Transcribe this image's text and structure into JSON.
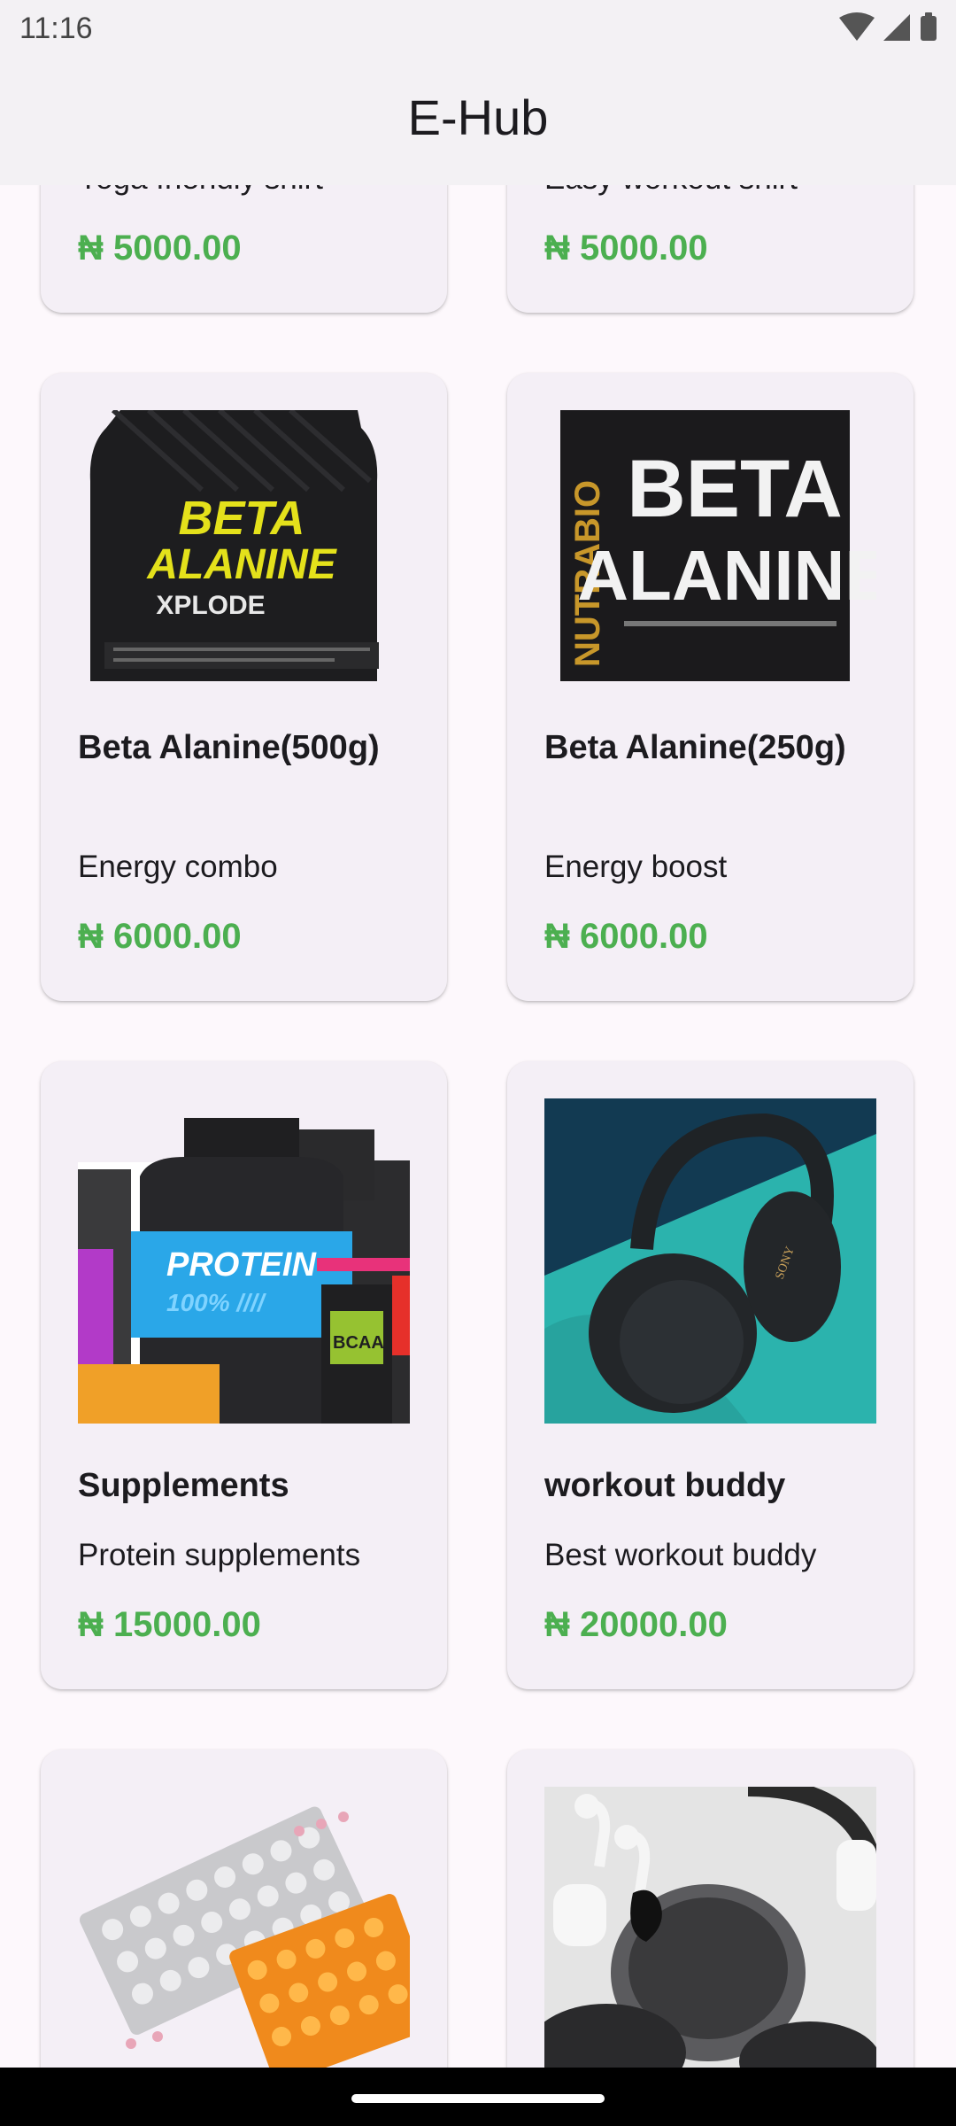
{
  "status_bar": {
    "time": "11:16",
    "icons": [
      "wifi-icon",
      "cellular-signal-icon",
      "battery-icon"
    ]
  },
  "app_bar": {
    "title": "E-Hub"
  },
  "currency_color": "#4caf50",
  "products": [
    {
      "name": "",
      "description": "Yoga friendly shirt",
      "price": "₦ 5000.00"
    },
    {
      "name": "",
      "description": "Easy workout shirt",
      "price": "₦ 5000.00"
    },
    {
      "name": "Beta Alanine(500g)",
      "description": "Energy combo",
      "price": "₦ 6000.00",
      "image": "beta-alanine-xplode-jar"
    },
    {
      "name": "Beta Alanine(250g)",
      "description": "Energy boost",
      "price": "₦ 6000.00",
      "image": "beta-alanine-nutrabio-jar"
    },
    {
      "name": "Supplements",
      "description": "Protein supplements",
      "price": "₦ 15000.00",
      "image": "protein-supplements"
    },
    {
      "name": "workout buddy",
      "description": "Best workout buddy",
      "price": "₦ 20000.00",
      "image": "sony-headphones"
    },
    {
      "name": "",
      "description": "",
      "price": "",
      "image": "pill-blister-packs"
    },
    {
      "name": "",
      "description": "",
      "price": "",
      "image": "apple-earbuds-headphones"
    }
  ],
  "product_image_labels": {
    "beta_500_line1": "BETA",
    "beta_500_line2": "ALANINE",
    "beta_500_line3": "XPLODE",
    "beta_250_brand": "NUTRABIO",
    "beta_250_line1": "BETA",
    "beta_250_line2": "ALANINE",
    "protein_label": "PROTEIN",
    "protein_sub": "100% ////",
    "bcaa_label": "BCAA",
    "sony_label": "SONY"
  }
}
